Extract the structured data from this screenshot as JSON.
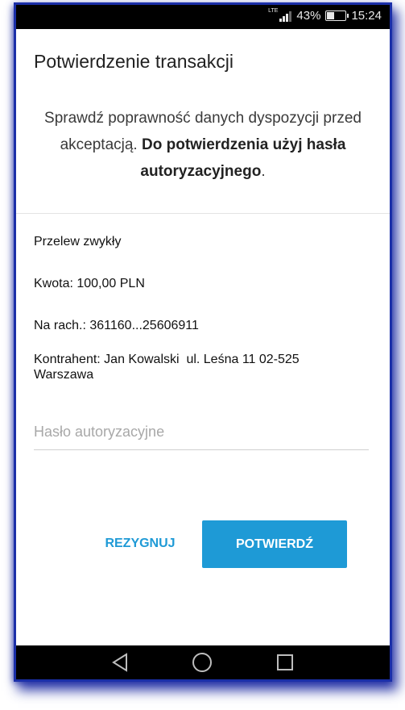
{
  "status_bar": {
    "network": "LTE",
    "battery_percent": "43%",
    "battery_level": 0.43,
    "time": "15:24"
  },
  "header": {
    "title": "Potwierdzenie transakcji"
  },
  "notice": {
    "text_normal": "Sprawdź poprawność danych dyspozycji przed akceptacją. ",
    "text_bold": "Do potwierdzenia użyj hasła autoryzacyjnego",
    "text_end": "."
  },
  "transaction": {
    "type": "Przelew zwykły",
    "amount": "Kwota: 100,00 PLN",
    "account": "Na rach.: 361160...25606911",
    "counterparty": "Kontrahent: Jan Kowalski  ul. Leśna 11 02-525 Warszawa"
  },
  "password_field": {
    "placeholder": "Hasło autoryzacyjne",
    "value": ""
  },
  "buttons": {
    "cancel": "REZYGNUJ",
    "confirm": "POTWIERDŹ"
  },
  "navigation": {
    "back_icon": "back-triangle-icon",
    "home_icon": "home-circle-icon",
    "recents_icon": "recents-square-icon"
  },
  "colors": {
    "accent": "#1e9ad6",
    "frame_glow": "#1b2fa8",
    "status_bar_bg": "#000000"
  }
}
